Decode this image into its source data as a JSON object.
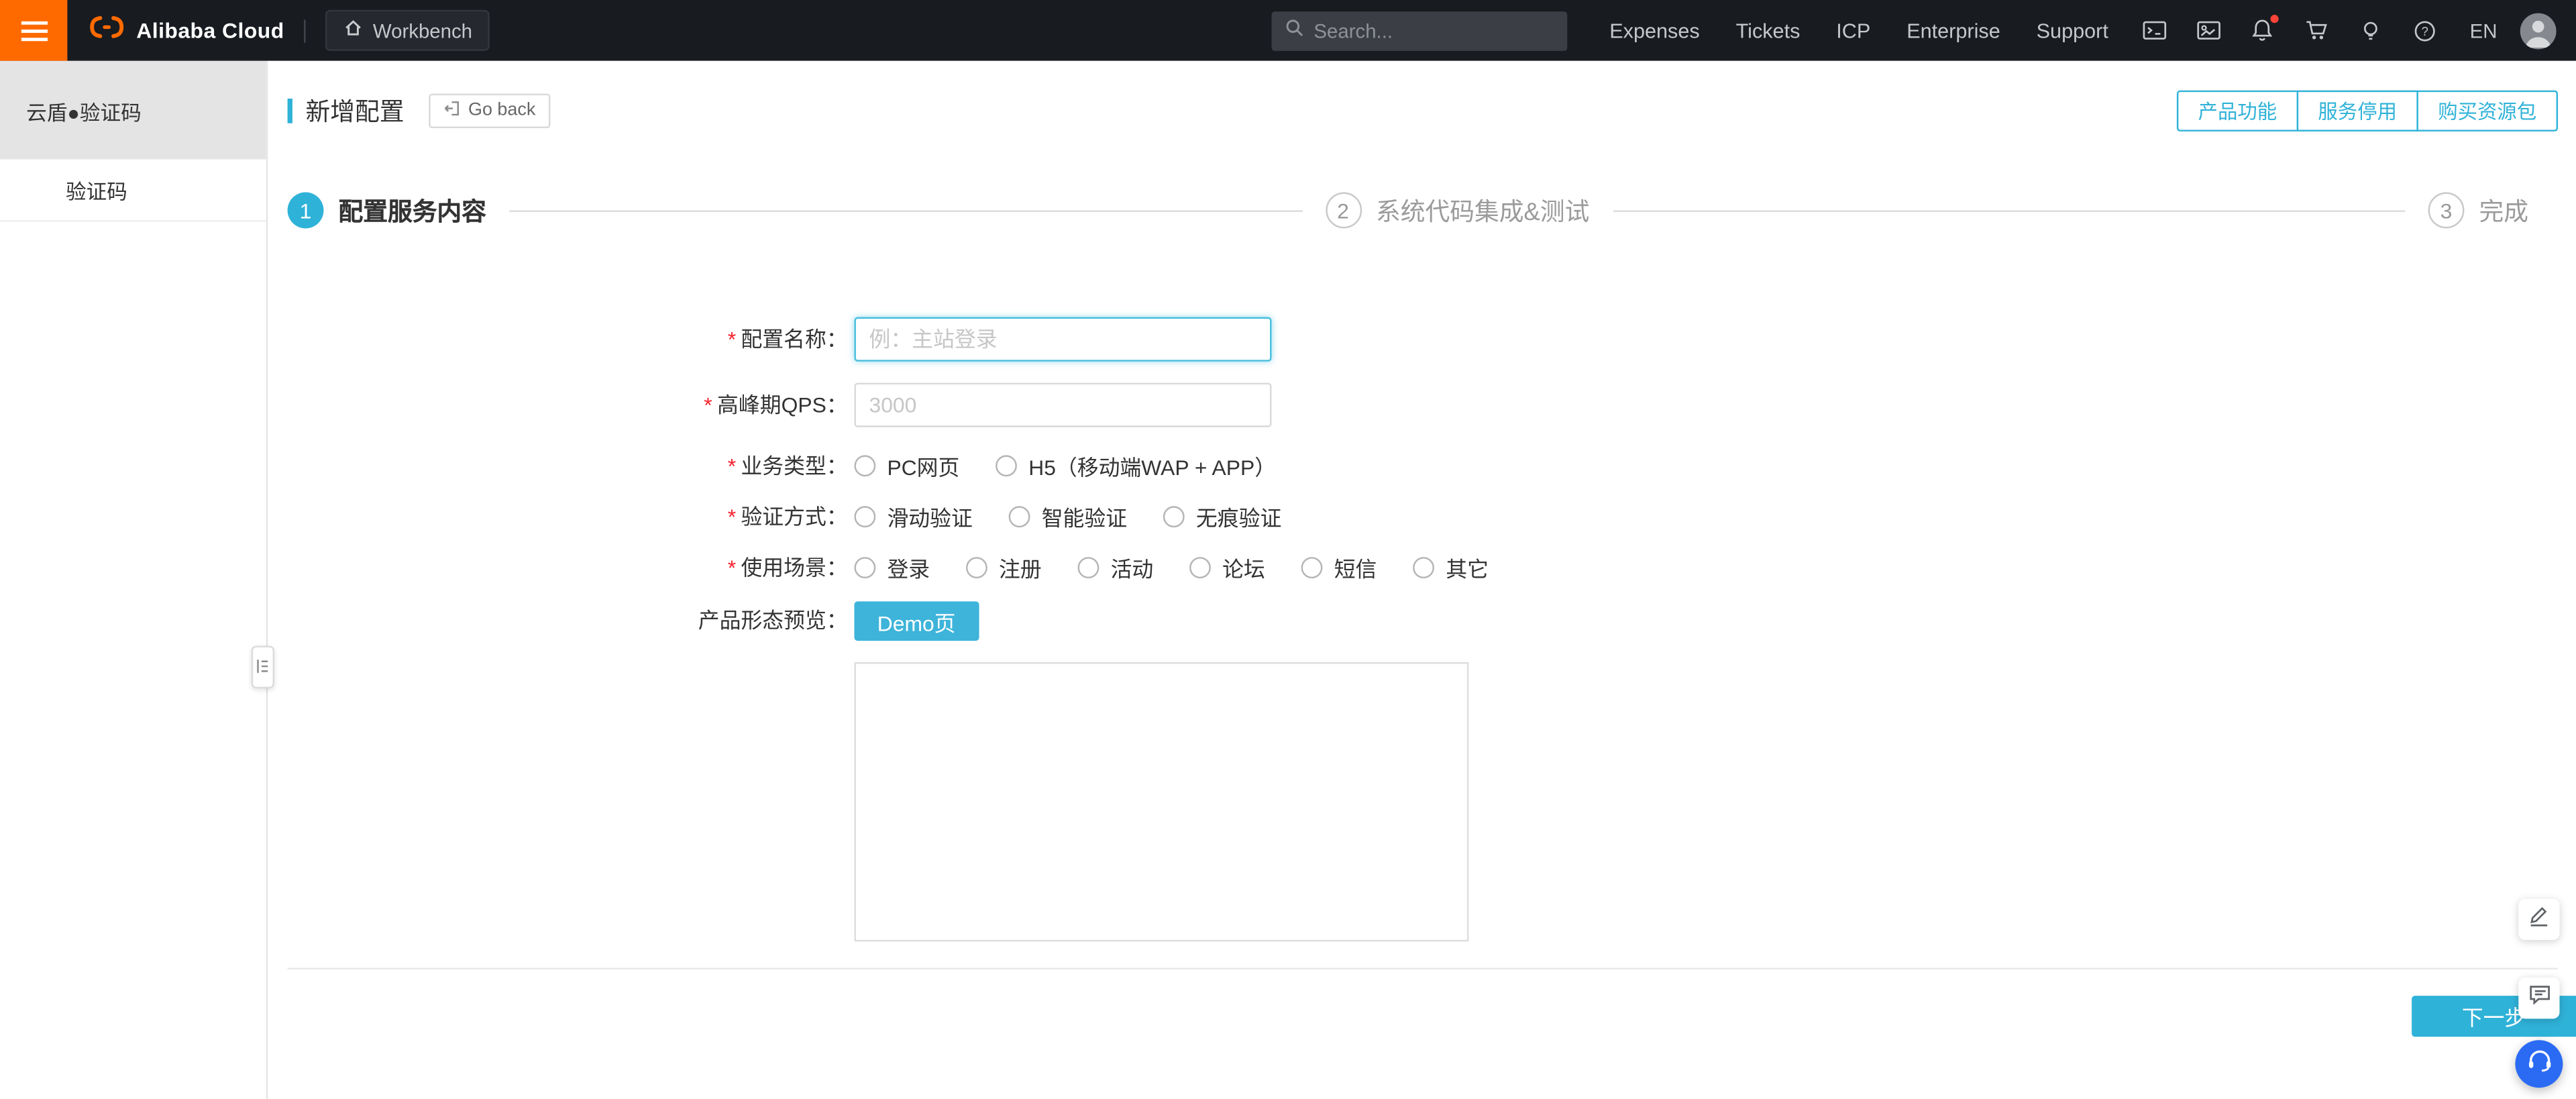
{
  "topbar": {
    "brand": "Alibaba Cloud",
    "workbench_label": "Workbench",
    "search_placeholder": "Search...",
    "nav": [
      "Expenses",
      "Tickets",
      "ICP",
      "Enterprise",
      "Support"
    ],
    "language": "EN"
  },
  "sidebar": {
    "product_title": "云盾●验证码",
    "items": [
      {
        "label": "验证码"
      }
    ]
  },
  "page_header": {
    "title": "新增配置",
    "go_back_label": "Go back",
    "actions": [
      "产品功能",
      "服务停用",
      "购买资源包"
    ]
  },
  "steps": [
    {
      "num": "1",
      "label": "配置服务内容"
    },
    {
      "num": "2",
      "label": "系统代码集成&测试"
    },
    {
      "num": "3",
      "label": "完成"
    }
  ],
  "form": {
    "required_mark": "*",
    "config_name": {
      "label": "配置名称：",
      "placeholder": "例：主站登录",
      "value": ""
    },
    "peak_qps": {
      "label": "高峰期QPS：",
      "placeholder": "3000",
      "value": ""
    },
    "business_type": {
      "label": "业务类型：",
      "options": [
        "PC网页",
        "H5（移动端WAP + APP）"
      ]
    },
    "verify_method": {
      "label": "验证方式：",
      "options": [
        "滑动验证",
        "智能验证",
        "无痕验证"
      ]
    },
    "use_scene": {
      "label": "使用场景：",
      "options": [
        "登录",
        "注册",
        "活动",
        "论坛",
        "短信",
        "其它"
      ]
    },
    "preview": {
      "label": "产品形态预览：",
      "demo_button": "Demo页"
    }
  },
  "footer": {
    "next_button": "下一步"
  },
  "colors": {
    "accent": "#2fb2d8",
    "orange": "#ff6a00",
    "required": "#f5222d"
  }
}
